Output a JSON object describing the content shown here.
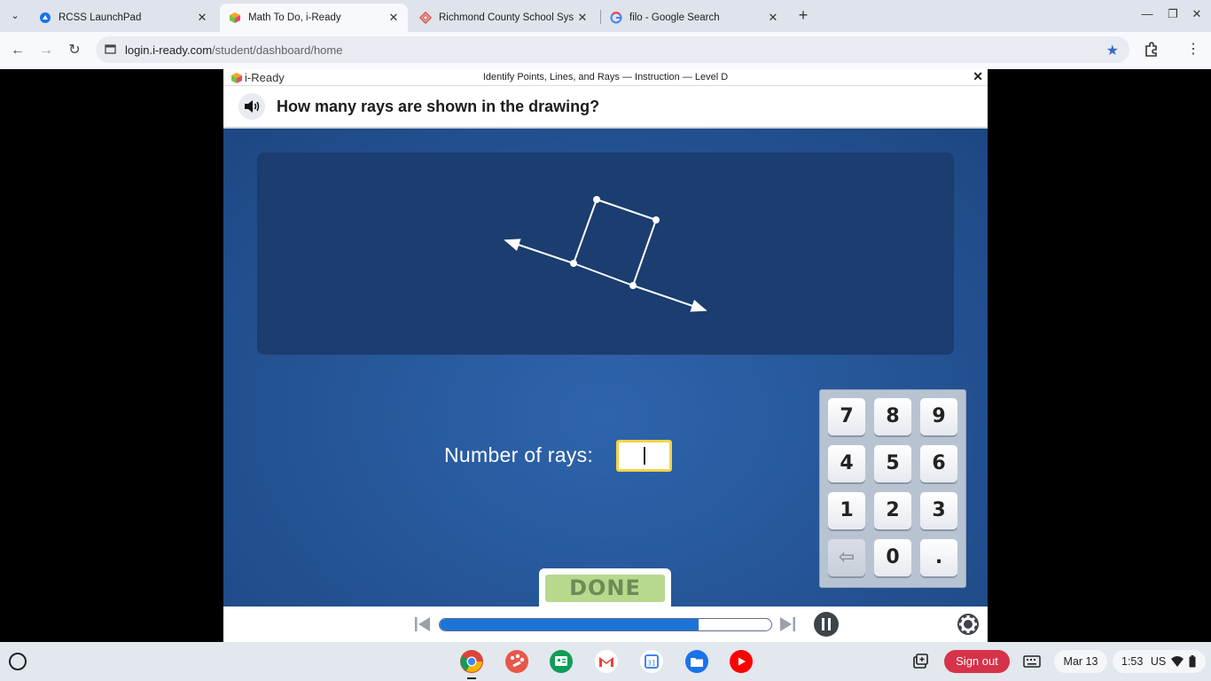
{
  "browser": {
    "tabs": [
      {
        "title": "RCSS LaunchPad",
        "favicon": "launchpad-icon"
      },
      {
        "title": "Math To Do, i-Ready",
        "favicon": "iready-icon"
      },
      {
        "title": "Richmond County School Syste",
        "favicon": "classlink-icon"
      },
      {
        "title": "filo - Google Search",
        "favicon": "google-icon"
      }
    ],
    "active_tab_index": 1,
    "url_host": "login.i-ready.com",
    "url_path": "/student/dashboard/home"
  },
  "app": {
    "logo_text": "i-Ready",
    "lesson_title": "Identify Points, Lines, and Rays — Instruction — Level D",
    "question": "How many rays are shown in the drawing?",
    "answer_label": "Number of rays:",
    "answer_value": "",
    "keypad": {
      "rows": [
        [
          "7",
          "8",
          "9"
        ],
        [
          "4",
          "5",
          "6"
        ],
        [
          "1",
          "2",
          "3"
        ],
        [
          "⇦",
          "0",
          "."
        ]
      ]
    },
    "done_label": "DONE",
    "progress": 0.78
  },
  "shelf": {
    "sign_out": "Sign out",
    "date": "Mar 13",
    "time": "1:53",
    "locale": "US"
  },
  "colors": {
    "stage_blue": "#2a5ba0",
    "panel_blue": "#1b3d6f",
    "input_border": "#f2d348",
    "done_green": "#b6d98d",
    "progress_fill": "#1e73d6",
    "sign_out_red": "#d6334a"
  }
}
